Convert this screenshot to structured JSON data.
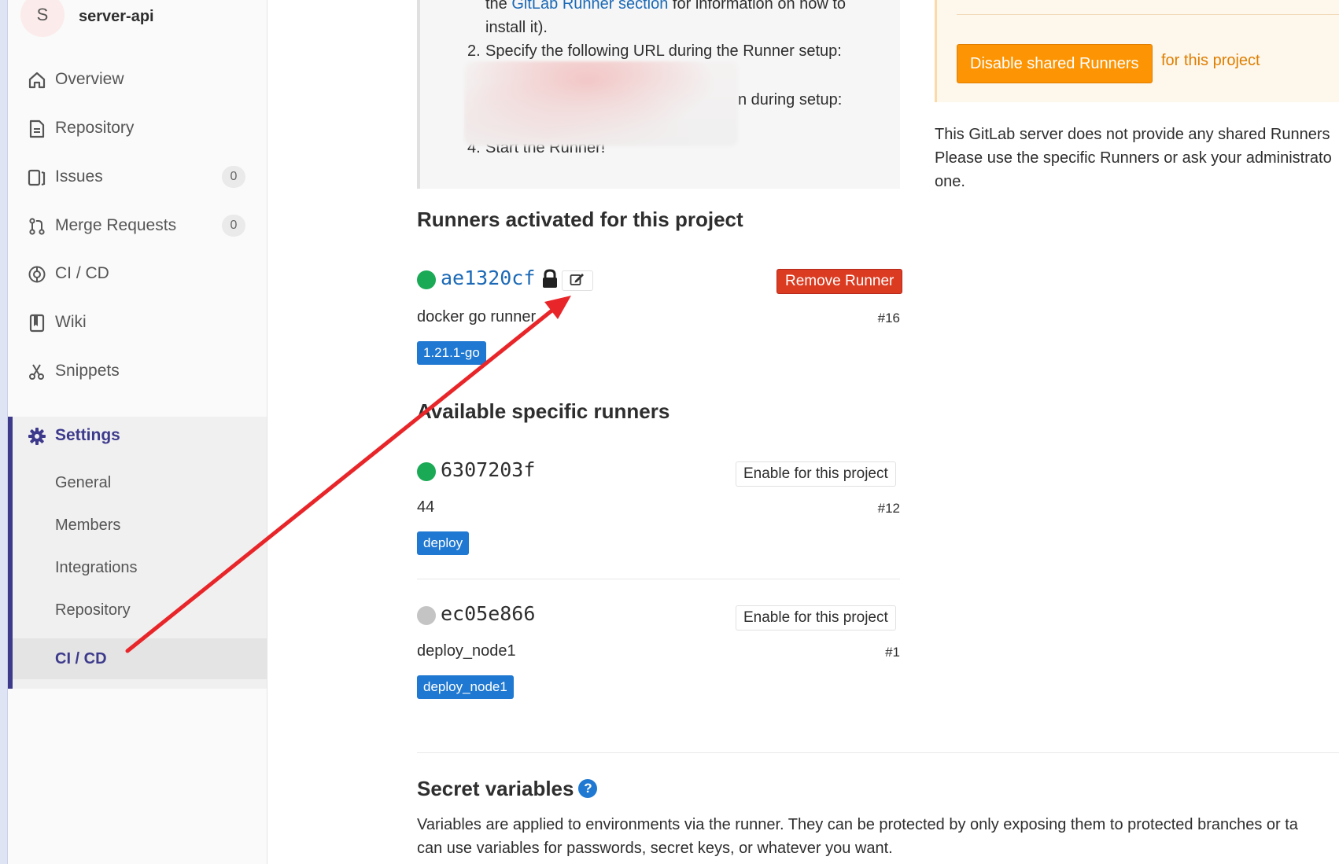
{
  "project": {
    "avatar_letter": "S",
    "name": "server-api"
  },
  "sidebar": {
    "items": [
      {
        "label": "Overview"
      },
      {
        "label": "Repository"
      },
      {
        "label": "Issues",
        "count": "0"
      },
      {
        "label": "Merge Requests",
        "count": "0"
      },
      {
        "label": "CI / CD"
      },
      {
        "label": "Wiki"
      },
      {
        "label": "Snippets"
      }
    ],
    "settings": {
      "label": "Settings",
      "subitems": [
        {
          "label": "General"
        },
        {
          "label": "Members"
        },
        {
          "label": "Integrations"
        },
        {
          "label": "Repository"
        },
        {
          "label": "CI / CD"
        }
      ]
    }
  },
  "install": {
    "line1_prefix": "the ",
    "line1_link": "GitLab Runner section",
    "line1_suffix": " for information on how to",
    "line2": "install it).",
    "step2_num": "2.",
    "step2": "Specify the following URL during the Runner setup:",
    "step3_tail": "n during setup:",
    "step4_num": "4.",
    "step4": "Start the Runner!"
  },
  "activated": {
    "heading": "Runners activated for this project",
    "runner": {
      "token": "ae1320cf",
      "description": "docker go runner",
      "id": "#16",
      "tag": "1.21.1-go",
      "remove_label": "Remove Runner",
      "status_color": "#1aaa55"
    }
  },
  "available": {
    "heading": "Available specific runners",
    "enable_label": "Enable for this project",
    "runners": [
      {
        "token": "6307203f",
        "description": "44",
        "id": "#12",
        "tag": "deploy",
        "status_color": "#1aaa55"
      },
      {
        "token": "ec05e866",
        "description": "deploy_node1",
        "id": "#1",
        "tag": "deploy_node1",
        "status_color": "#c4c4c4"
      }
    ]
  },
  "shared": {
    "button_label": "Disable shared Runners",
    "suffix": "for this project",
    "info_line1": "This GitLab server does not provide any shared Runners",
    "info_line2": "Please use the specific Runners or ask your administrato",
    "info_line3": "one."
  },
  "secret": {
    "heading": "Secret variables",
    "help_glyph": "?",
    "desc_line1": "Variables are applied to environments via the runner. They can be protected by only exposing them to protected branches or ta",
    "desc_line2": "can use variables for passwords, secret keys, or whatever you want."
  },
  "colors": {
    "accent": "#3d3a8c",
    "link": "#1b69b6",
    "tag": "#1f78d1",
    "danger": "#db3b21",
    "warning": "#fc9403",
    "annotation_arrow": "#e8262a"
  }
}
